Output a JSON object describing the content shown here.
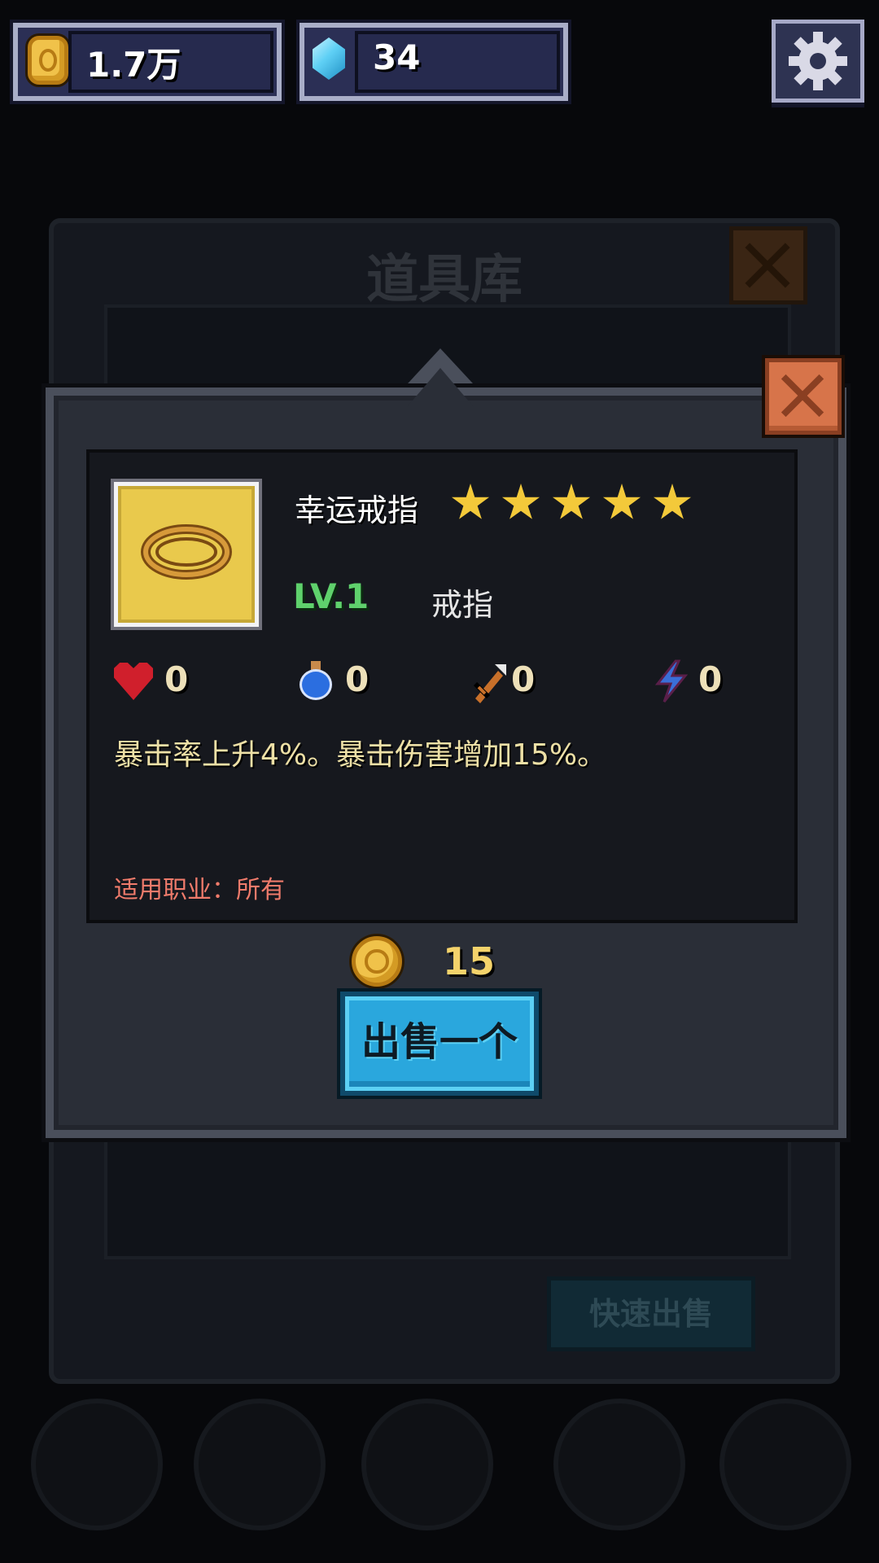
{
  "hud": {
    "gold": "1.7万",
    "gems": "34"
  },
  "storage_window": {
    "title": "道具库",
    "quick_sell_label": "快速出售"
  },
  "item_dialog": {
    "name": "幸运戒指",
    "rarity_stars": 5,
    "level": "LV.1",
    "type": "戒指",
    "stats": {
      "health": "0",
      "mana": "0",
      "attack": "0",
      "energy": "0"
    },
    "description": "暴击率上升4%。暴击伤害增加15%。",
    "applicable_class": "适用职业：所有",
    "price": "15",
    "sell_button_label": "出售一个"
  },
  "colors": {
    "accent_gold": "#f0c24a",
    "sell_button": "#2aa7dd",
    "close_button": "#d7744a",
    "level_green": "#5fd16c",
    "class_text_red": "#f07b6b"
  }
}
